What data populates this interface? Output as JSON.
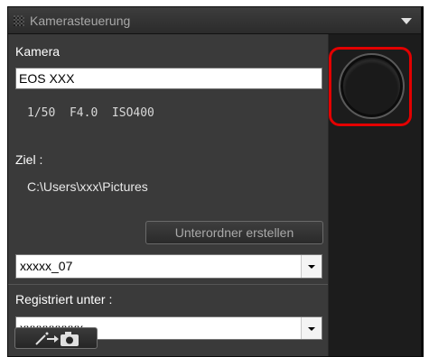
{
  "panel": {
    "title": "Kamerasteuerung",
    "collapse_icon": "chevron-down-icon",
    "grip_icon": "grip-icon"
  },
  "camera": {
    "label": "Kamera",
    "model": "EOS XXX",
    "settings": "1/50  F4.0  ISO400"
  },
  "destination": {
    "label": "Ziel :",
    "path": "C:\\Users\\xxx\\Pictures",
    "create_subfolder_label": "Unterordner erstellen",
    "folder_value": "xxxxx_07"
  },
  "registered": {
    "label": "Registriert unter :",
    "value": "xxxxxxxxxx"
  },
  "transfer_button_icon": "magic-wand-camera-icon",
  "shutter_icon": "shutter-button-icon",
  "colors": {
    "highlight": "#e30000",
    "panel_bg": "#3a3a3a",
    "dark_bg": "#1c1c1c"
  }
}
